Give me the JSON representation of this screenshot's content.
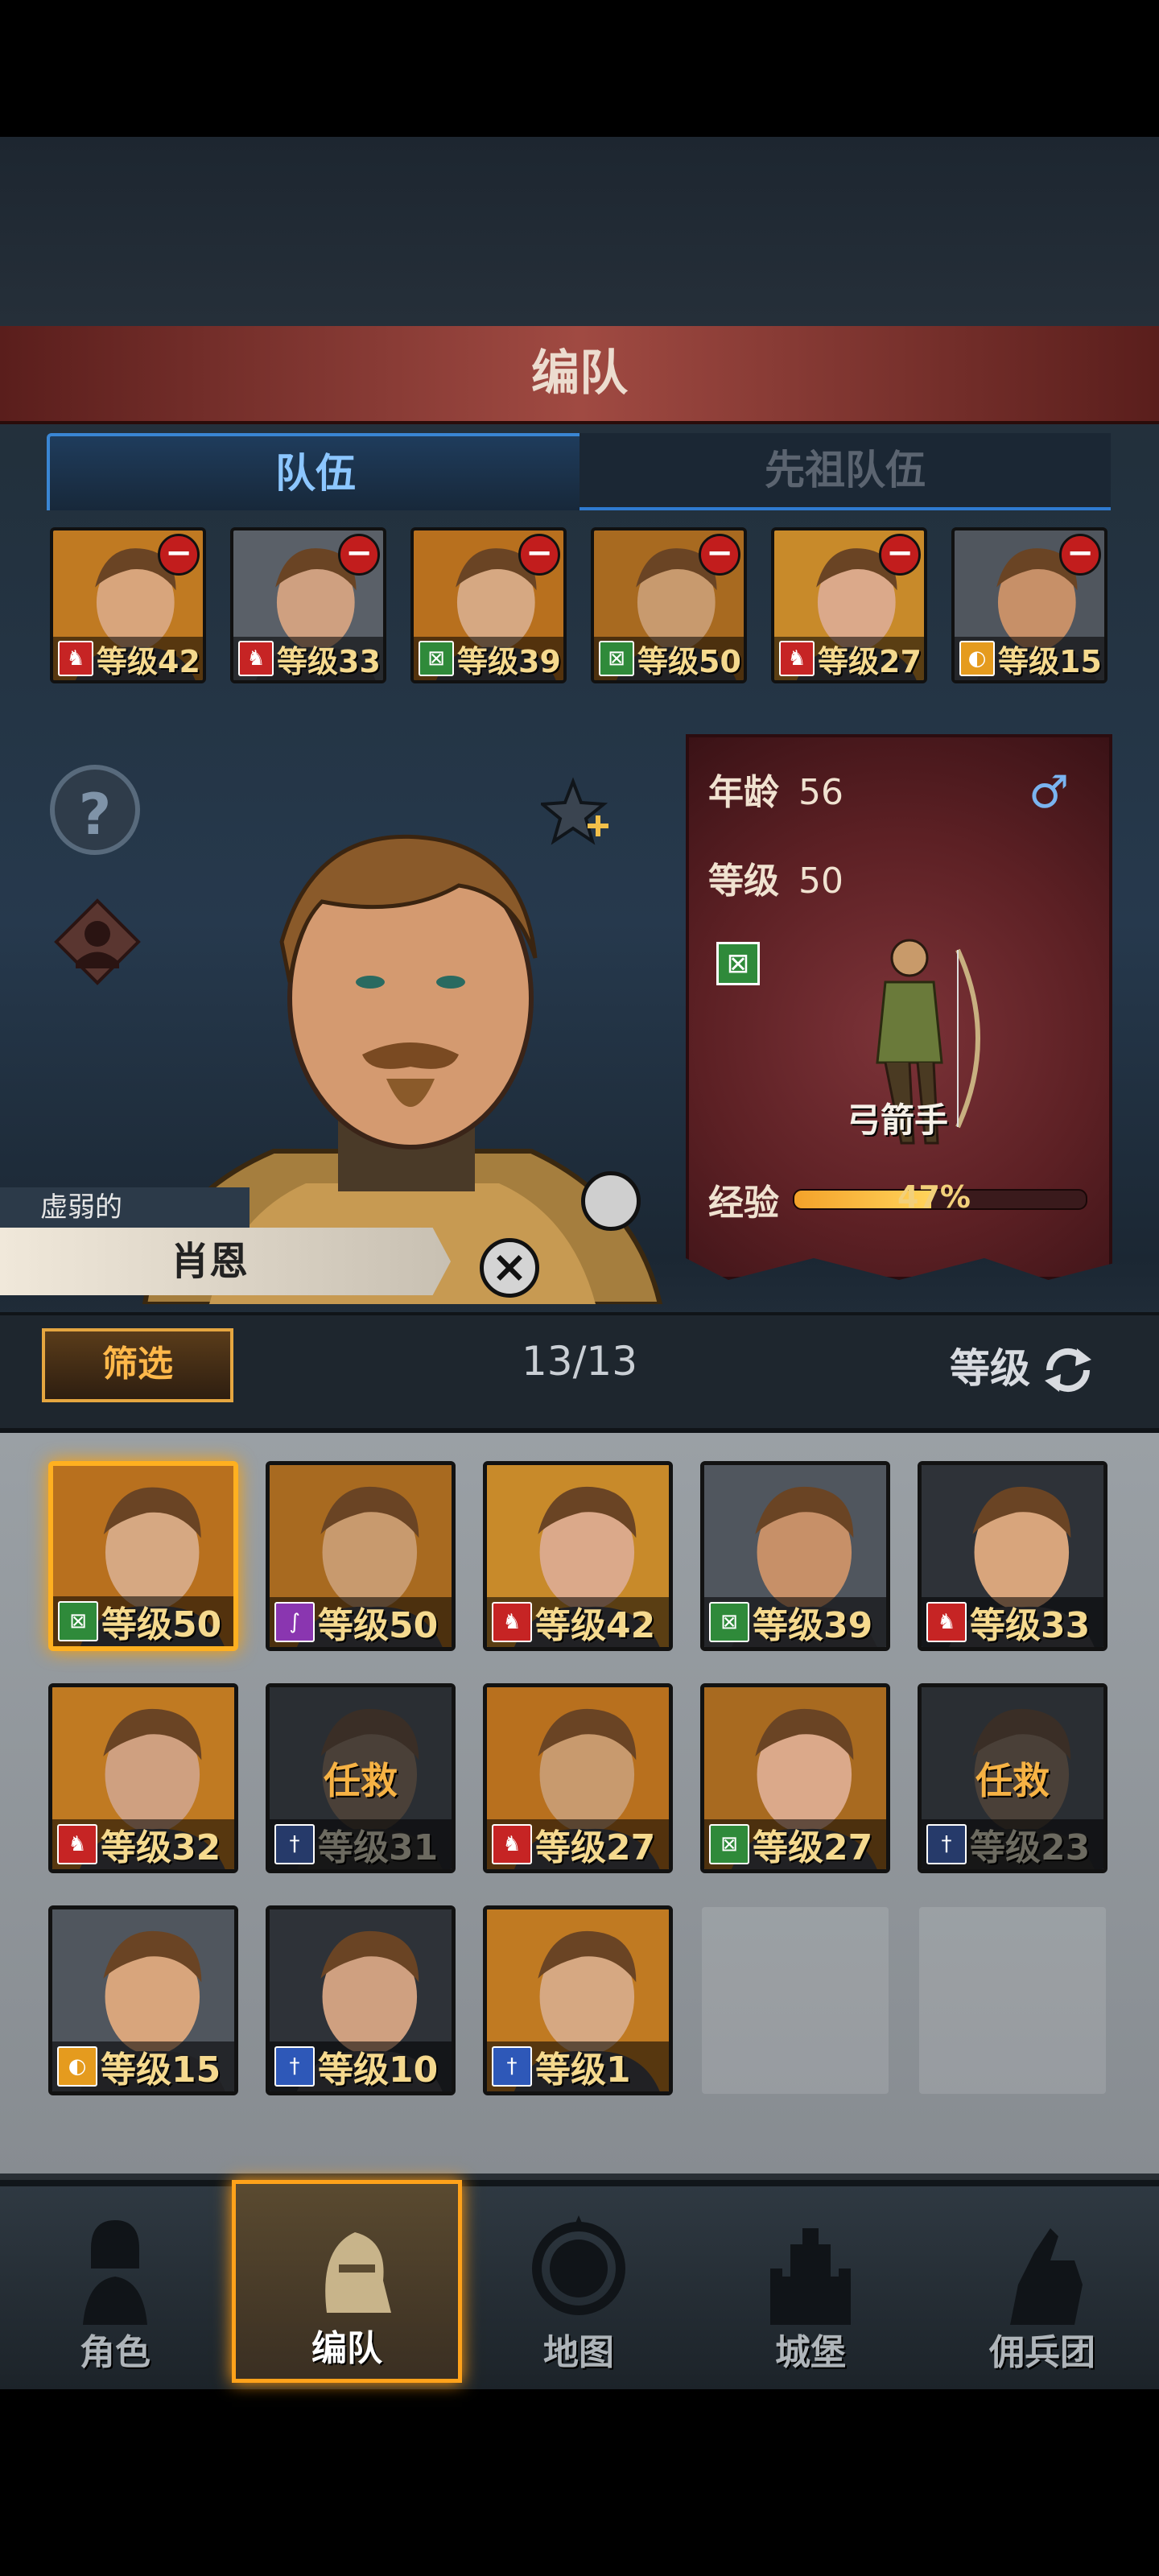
{
  "screen_title": "编队",
  "tabs": [
    {
      "label": "队伍",
      "active": true
    },
    {
      "label": "先祖队伍",
      "active": false
    }
  ],
  "team_slots": [
    {
      "level": "等级42",
      "class_icon": "horse-icon",
      "class_color": "#c62424",
      "flag_icon": true
    },
    {
      "level": "等级33",
      "class_icon": "horse-icon",
      "class_color": "#c62424"
    },
    {
      "level": "等级39",
      "class_icon": "bow-icon",
      "class_color": "#2f8a3a"
    },
    {
      "level": "等级50",
      "class_icon": "bow-icon",
      "class_color": "#2f8a3a"
    },
    {
      "level": "等级27",
      "class_icon": "horse-icon",
      "class_color": "#c62424"
    },
    {
      "level": "等级15",
      "class_icon": "shield-icon",
      "class_color": "#e59b1e"
    }
  ],
  "character": {
    "trait": "虚弱的",
    "name": "肖恩",
    "age_label": "年龄",
    "age": "56",
    "level_label": "等级",
    "level": "50",
    "gender_icon": "male-icon",
    "class_name": "弓箭手",
    "exp_label": "经验",
    "exp_percent_text": "47%",
    "exp_fraction": 0.47
  },
  "filter": {
    "button_label": "筛选",
    "count": "13/13",
    "sort_label": "等级"
  },
  "roster": [
    {
      "level": "等级50",
      "class_icon": "bow-icon",
      "class_color": "#2f8a3a",
      "selected": true,
      "mission": ""
    },
    {
      "level": "等级50",
      "class_icon": "staff-icon",
      "class_color": "#8a36b0",
      "selected": false,
      "mission": ""
    },
    {
      "level": "等级42",
      "class_icon": "horse-icon",
      "class_color": "#c62424",
      "selected": false,
      "mission": ""
    },
    {
      "level": "等级39",
      "class_icon": "bow-icon",
      "class_color": "#2f8a3a",
      "selected": false,
      "mission": ""
    },
    {
      "level": "等级33",
      "class_icon": "horse-icon",
      "class_color": "#c62424",
      "selected": false,
      "mission": ""
    },
    {
      "level": "等级32",
      "class_icon": "horse-icon",
      "class_color": "#c62424",
      "selected": false,
      "mission": ""
    },
    {
      "level": "等级31",
      "class_icon": "sword-icon",
      "class_color": "#2e58b8",
      "selected": false,
      "mission": "任救"
    },
    {
      "level": "等级27",
      "class_icon": "horse-icon",
      "class_color": "#c62424",
      "selected": false,
      "mission": ""
    },
    {
      "level": "等级27",
      "class_icon": "bow-icon",
      "class_color": "#2f8a3a",
      "selected": false,
      "mission": ""
    },
    {
      "level": "等级23",
      "class_icon": "sword-icon",
      "class_color": "#2e58b8",
      "selected": false,
      "mission": "任救"
    },
    {
      "level": "等级15",
      "class_icon": "shield-icon",
      "class_color": "#e59b1e",
      "selected": false,
      "mission": ""
    },
    {
      "level": "等级10",
      "class_icon": "sword-icon",
      "class_color": "#2e58b8",
      "selected": false,
      "mission": ""
    },
    {
      "level": "等级1",
      "class_icon": "sword-icon",
      "class_color": "#2e58b8",
      "selected": false,
      "mission": ""
    }
  ],
  "nav": [
    {
      "label": "角色",
      "icon": "knight-icon",
      "active": false
    },
    {
      "label": "编队",
      "icon": "helmet-icon",
      "active": true
    },
    {
      "label": "地图",
      "icon": "compass-icon",
      "active": false
    },
    {
      "label": "城堡",
      "icon": "castle-icon",
      "active": false
    },
    {
      "label": "佣兵团",
      "icon": "fist-icon",
      "active": false
    }
  ]
}
